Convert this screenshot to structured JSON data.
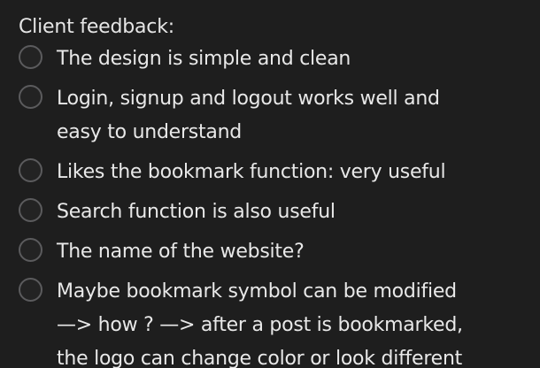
{
  "note": {
    "heading": "Client feedback:",
    "items": [
      {
        "checked": false,
        "lines": [
          "The design is simple and clean"
        ]
      },
      {
        "checked": false,
        "lines": [
          "Login, signup and logout works well and",
          "easy to understand"
        ]
      },
      {
        "checked": false,
        "lines": [
          "Likes the bookmark function: very useful"
        ]
      },
      {
        "checked": false,
        "lines": [
          "Search function is also useful"
        ]
      },
      {
        "checked": false,
        "lines": [
          "The name of the website?"
        ]
      },
      {
        "checked": false,
        "lines": [
          "Maybe bookmark symbol can be modified",
          "—> how ? —> after a post is bookmarked,",
          "the logo can change color or look different"
        ]
      }
    ]
  },
  "colors": {
    "background": "#1e1e1e",
    "text": "#e8e8e8",
    "checkbox_border": "#5b5b5d"
  }
}
